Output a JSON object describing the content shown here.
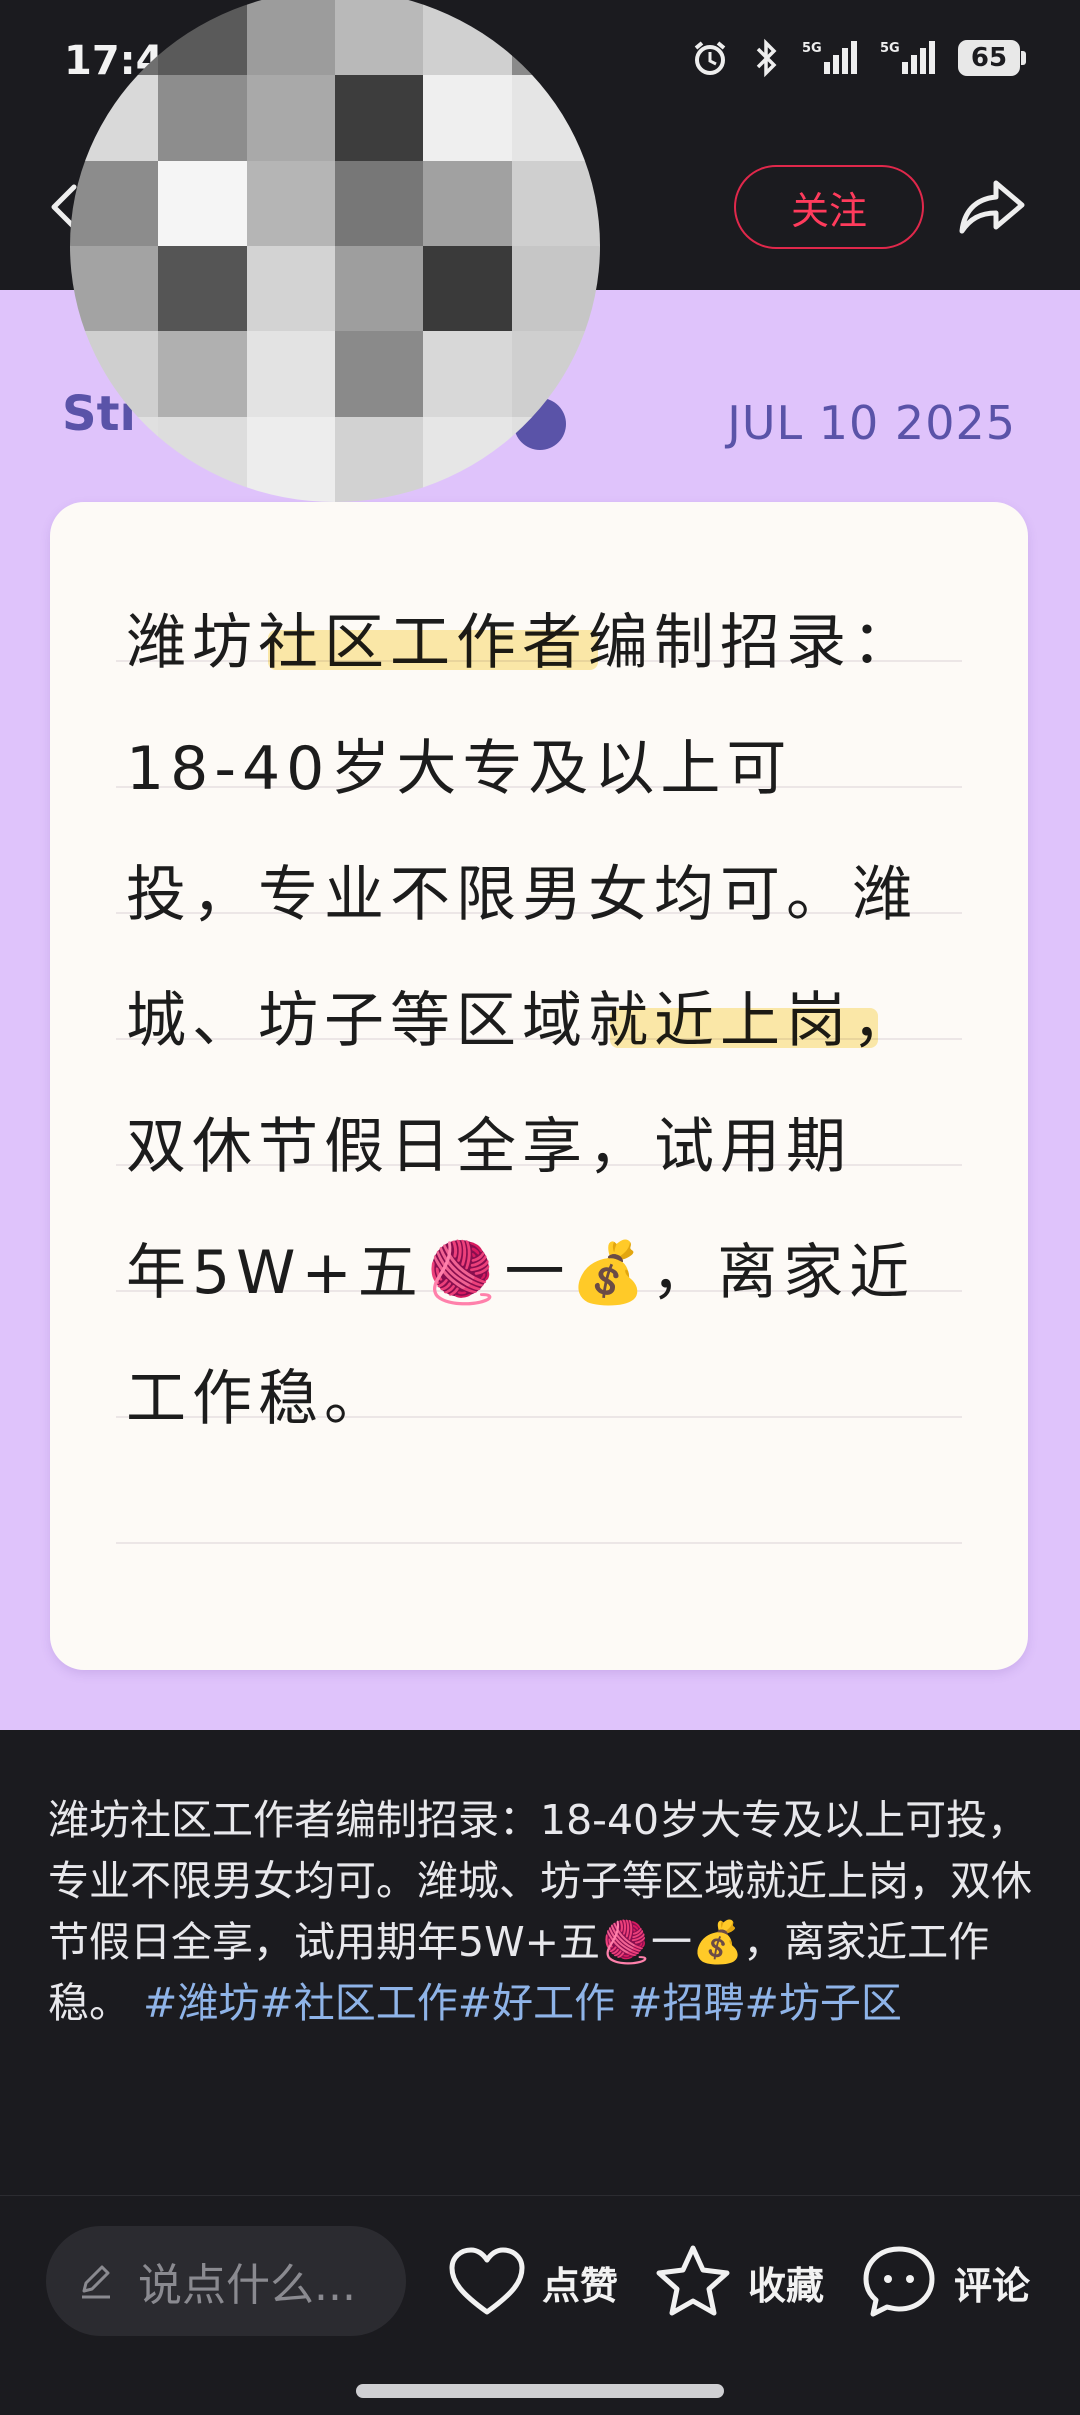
{
  "status_bar": {
    "time": "17:4",
    "battery": "65"
  },
  "nav": {
    "follow_label": "关注"
  },
  "post_image": {
    "author_partial": "Sti",
    "date": "JUL 10 2025",
    "note_lines": [
      "潍坊社区工作者编制招录：",
      "18-40岁大专及以上可",
      "投，专业不限男女均可。潍",
      "城、坊子等区域就近上岗，",
      "双休节假日全享，试用期",
      "年5W+五🧶一💰，离家近",
      "工作稳。"
    ]
  },
  "caption": {
    "text": "潍坊社区工作者编制招录：18-40岁大专及以上可投，专业不限男女均可。潍城、坊子等区域就近上岗，双休节假日全享，试用期年5W+五🧶一💰，离家近工作稳。",
    "tags": [
      "#潍坊",
      "#社区工作",
      "#好工作",
      "#招聘",
      "#坊子区"
    ]
  },
  "bottom_bar": {
    "comment_placeholder": "说点什么...",
    "like_label": "点赞",
    "collect_label": "收藏",
    "comment_label": "评论"
  },
  "colors": {
    "accent": "#ff3b5c",
    "image_bg": "#dfc3fb",
    "tag": "#8fb4e8"
  }
}
